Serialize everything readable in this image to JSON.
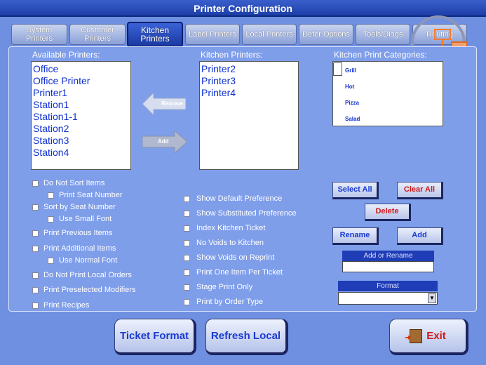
{
  "window": {
    "title": "Printer Configuration"
  },
  "tabs": [
    {
      "label_line1": "System",
      "label_line2": "Printers"
    },
    {
      "label_line1": "Customer",
      "label_line2": "Printers"
    },
    {
      "label_line1": "Kitchen",
      "label_line2": "Printers"
    },
    {
      "label_line1": "Label Printers",
      "label_line2": ""
    },
    {
      "label_line1": "Local Printers",
      "label_line2": ""
    },
    {
      "label_line1": "Defer Options",
      "label_line2": ""
    },
    {
      "label_line1": "Tools/Diags",
      "label_line2": ""
    },
    {
      "label_line1": "Routing",
      "label_line2": ""
    }
  ],
  "available": {
    "header": "Available Printers:",
    "items": [
      "Office",
      "Office Printer",
      "Printer1",
      "Station1",
      "Station1-1",
      "Station2",
      "Station3",
      "Station4"
    ]
  },
  "kitchen": {
    "header": "Kitchen Printers:",
    "items": [
      "Printer2",
      "Printer3",
      "Printer4"
    ]
  },
  "categories": {
    "header": "Kitchen Print Categories:",
    "items": [
      "Grill",
      "Hot",
      "Pizza",
      "Salad"
    ]
  },
  "move": {
    "remove_label": "Remove",
    "add_label": "Add"
  },
  "options_left": {
    "do_not_sort": "Do Not Sort Items",
    "print_seat_number": "Print Seat Number",
    "sort_by_seat": "Sort by Seat Number",
    "use_small_font": "Use Small Font",
    "print_previous": "Print Previous Items",
    "print_additional": "Print Additional Items",
    "use_normal_font": "Use Normal Font",
    "do_not_print_local": "Do Not Print Local Orders",
    "print_preselected": "Print Preselected Modifiers",
    "print_recipes": "Print Recipes"
  },
  "options_mid": {
    "show_default": "Show Default Preference",
    "show_substituted": "Show Substituted Preference",
    "index_ticket": "Index Kitchen Ticket",
    "no_voids": "No Voids to Kitchen",
    "show_voids_reprint": "Show Voids on Reprint",
    "one_item_per_ticket": "Print One Item Per Ticket",
    "stage_print_only": "Stage Print Only",
    "print_by_order_type": "Print by Order Type"
  },
  "right_buttons": {
    "select_all": "Select All",
    "clear_all": "Clear All",
    "delete": "Delete",
    "rename": "Rename",
    "add": "Add"
  },
  "add_or_rename": {
    "label": "Add or Rename",
    "value": ""
  },
  "format": {
    "label": "Format",
    "selected": ""
  },
  "bottom": {
    "ticket_format": "Ticket Format",
    "refresh_local": "Refresh Local",
    "exit": "Exit"
  },
  "colors": {
    "exit_text": "#d01818",
    "accent": "#1f3db6"
  }
}
